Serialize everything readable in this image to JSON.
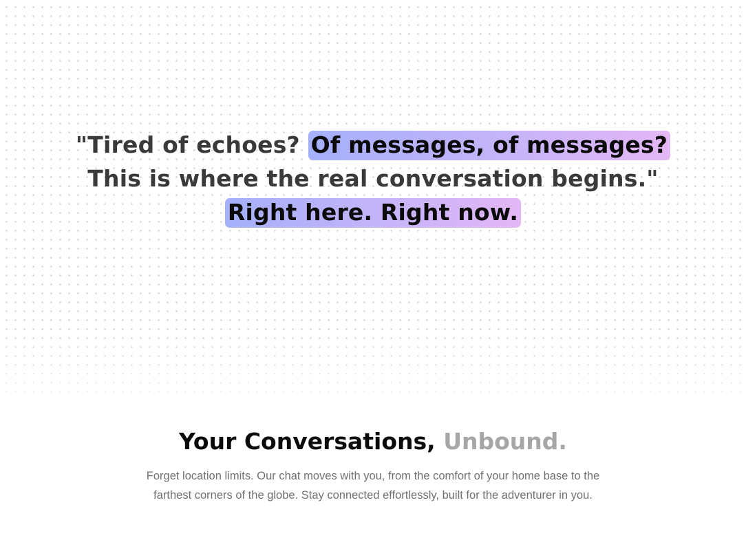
{
  "hero": {
    "quote_line1_plain": "\"Tired of echoes? ",
    "quote_line1_highlight": "Of messages, of messages?",
    "quote_line2": "This is where the real conversation begins.\"",
    "quote_line3_highlight": "Right here. Right now."
  },
  "features": {
    "title_main": "Your Conversations, ",
    "title_accent": "Unbound.",
    "description": "Forget location limits. Our chat moves with you, from the comfort of your home base to the farthest corners of the globe. Stay connected effortlessly, built for the adventurer in you."
  }
}
